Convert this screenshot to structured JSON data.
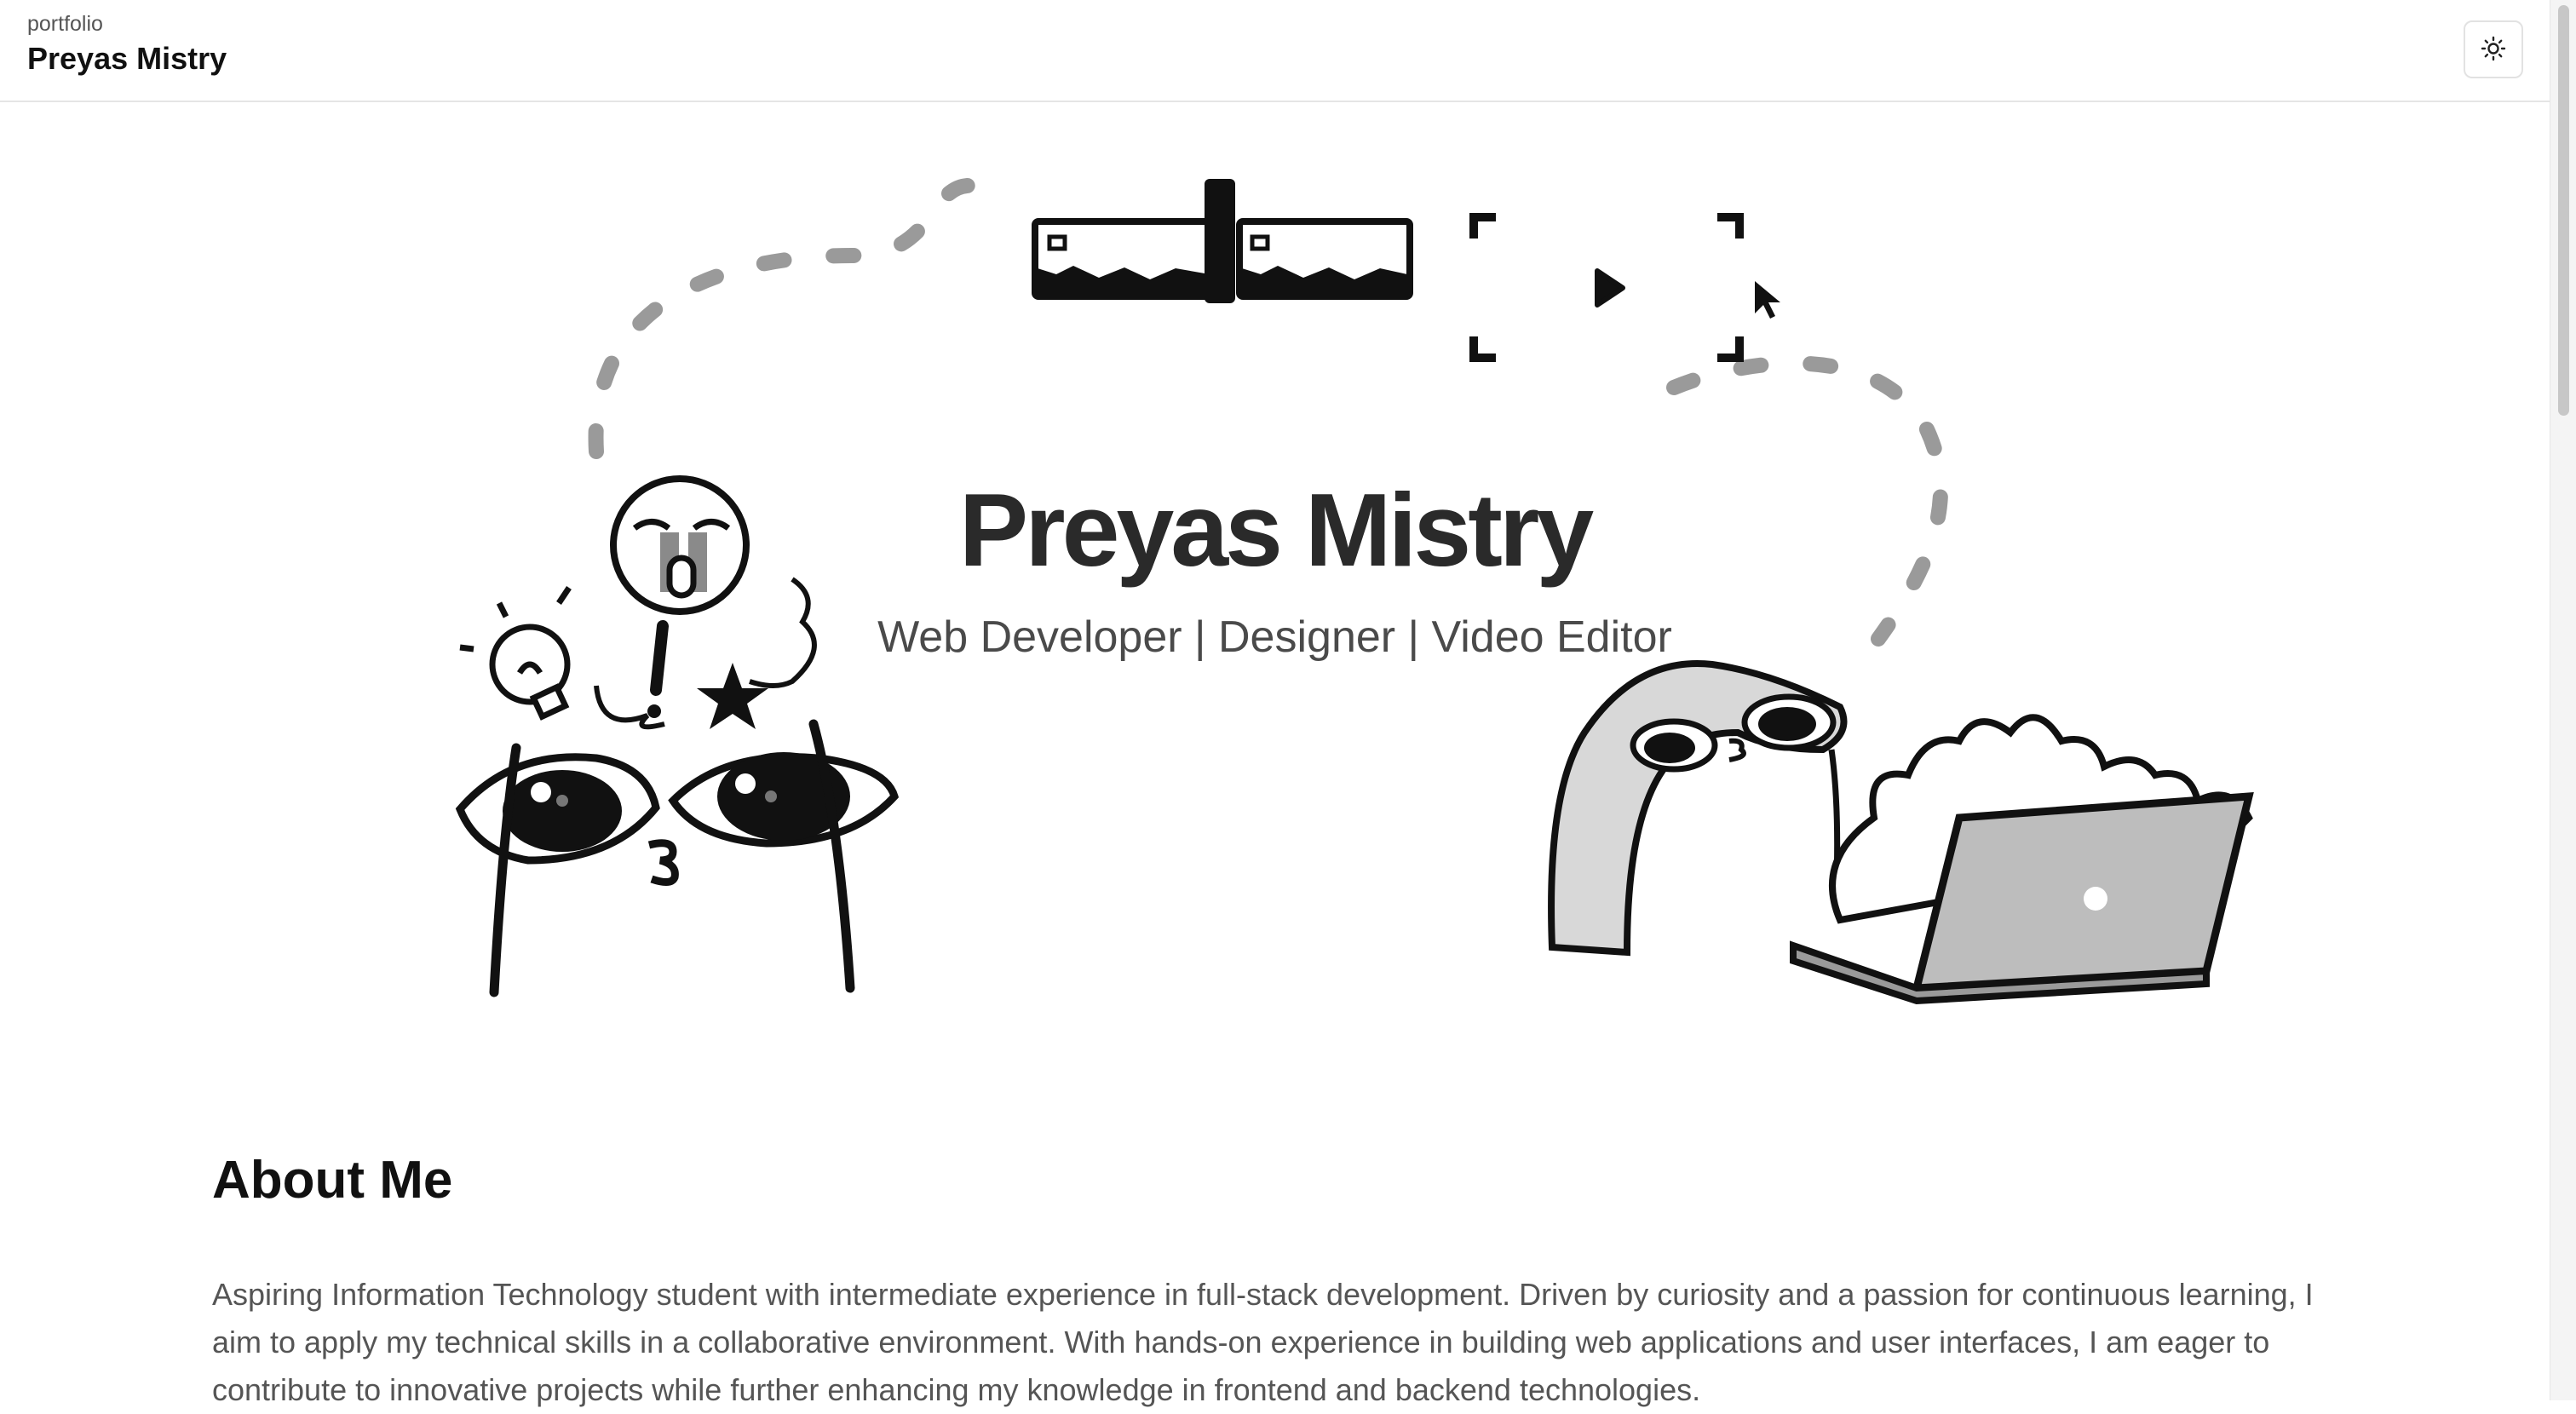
{
  "header": {
    "subtitle": "portfolio",
    "name": "Preyas Mistry",
    "theme_toggle_icon": "sun-icon"
  },
  "hero": {
    "name": "Preyas Mistry",
    "roles": "Web Developer | Designer | Video Editor",
    "illustration_icons": [
      "video-player-icon",
      "play-icon",
      "cursor-icon",
      "lightbulb-icon",
      "star-icon",
      "laptop-icon",
      "flame-icon"
    ]
  },
  "about": {
    "title": "About Me",
    "text": "Aspiring Information Technology student with intermediate experience in full-stack development. Driven by curiosity and a passion for continuous learning, I aim to apply my technical skills in a collaborative environment. With hands-on experience in building web applications and user interfaces, I am eager to contribute to innovative projects while further enhancing my knowledge in frontend and backend technologies."
  },
  "colors": {
    "background": "#ffffff",
    "text": "#111111",
    "muted": "#555555",
    "border": "#e5e5e5"
  }
}
